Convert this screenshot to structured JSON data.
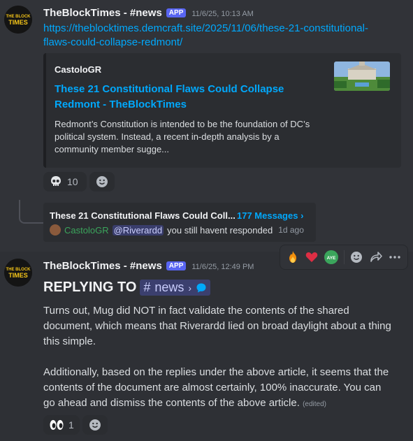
{
  "message1": {
    "author": "TheBlockTimes - #news",
    "tag": "APP",
    "timestamp": "11/6/25, 10:13 AM",
    "avatar_text": "THE BLOCK TIMES",
    "link_line1": "https://theblocktimes.demcraft.site/2025/11/06/these-21-constitutional-",
    "link_line2": "flaws-could-collapse-redmont/",
    "embed": {
      "provider": "CastoloGR",
      "title": "These 21 Constitutional Flaws Could Collapse Redmont - TheBlockTimes",
      "description": "Redmont’s Constitution is intended to be the foundation of DC’s political system. Instead, a recent in-depth analysis by a community member sugge..."
    },
    "reaction": {
      "icon": "skull-emoji",
      "count": "10"
    }
  },
  "thread": {
    "title": "These 21 Constitutional Flaws Could Coll...",
    "count": "177 Messages ›",
    "last_user": "CastoloGR",
    "mention": "@Riverardd",
    "last_text": "you still havent responded",
    "last_time": "1d ago"
  },
  "toolbar": {
    "icons": [
      "fire-emoji",
      "heart-emoji",
      "aye-emoji",
      "add-reaction-icon",
      "forward-icon",
      "more-icon"
    ],
    "aye_label": "AYE"
  },
  "message2": {
    "author": "TheBlockTimes - #news",
    "tag": "APP",
    "timestamp": "11/6/25, 12:49 PM",
    "avatar_text": "THE BLOCK TIMES",
    "replying_label": "REPLYING TO",
    "channel_hash": "#",
    "channel_name": "news",
    "channel_chevron": "›",
    "paragraph1": "Turns out, Mug did NOT in fact validate the contents of the shared document, which means that Riverardd lied on broad daylight about a thing this simple.",
    "paragraph2": "Additionally, based on the replies under the above article, it seems that the contents of the document are almost certainly, 100% inaccurate. You can go ahead and dismiss the contents of the above article.",
    "edited": "(edited)",
    "reaction": {
      "icon": "eyes-emoji",
      "count": "1"
    }
  },
  "colors": {
    "background": "#313338",
    "link": "#00a8fc",
    "app_tag": "#5865f2",
    "mention_bg": "#3c4270",
    "thread_user": "#3ba55c"
  }
}
